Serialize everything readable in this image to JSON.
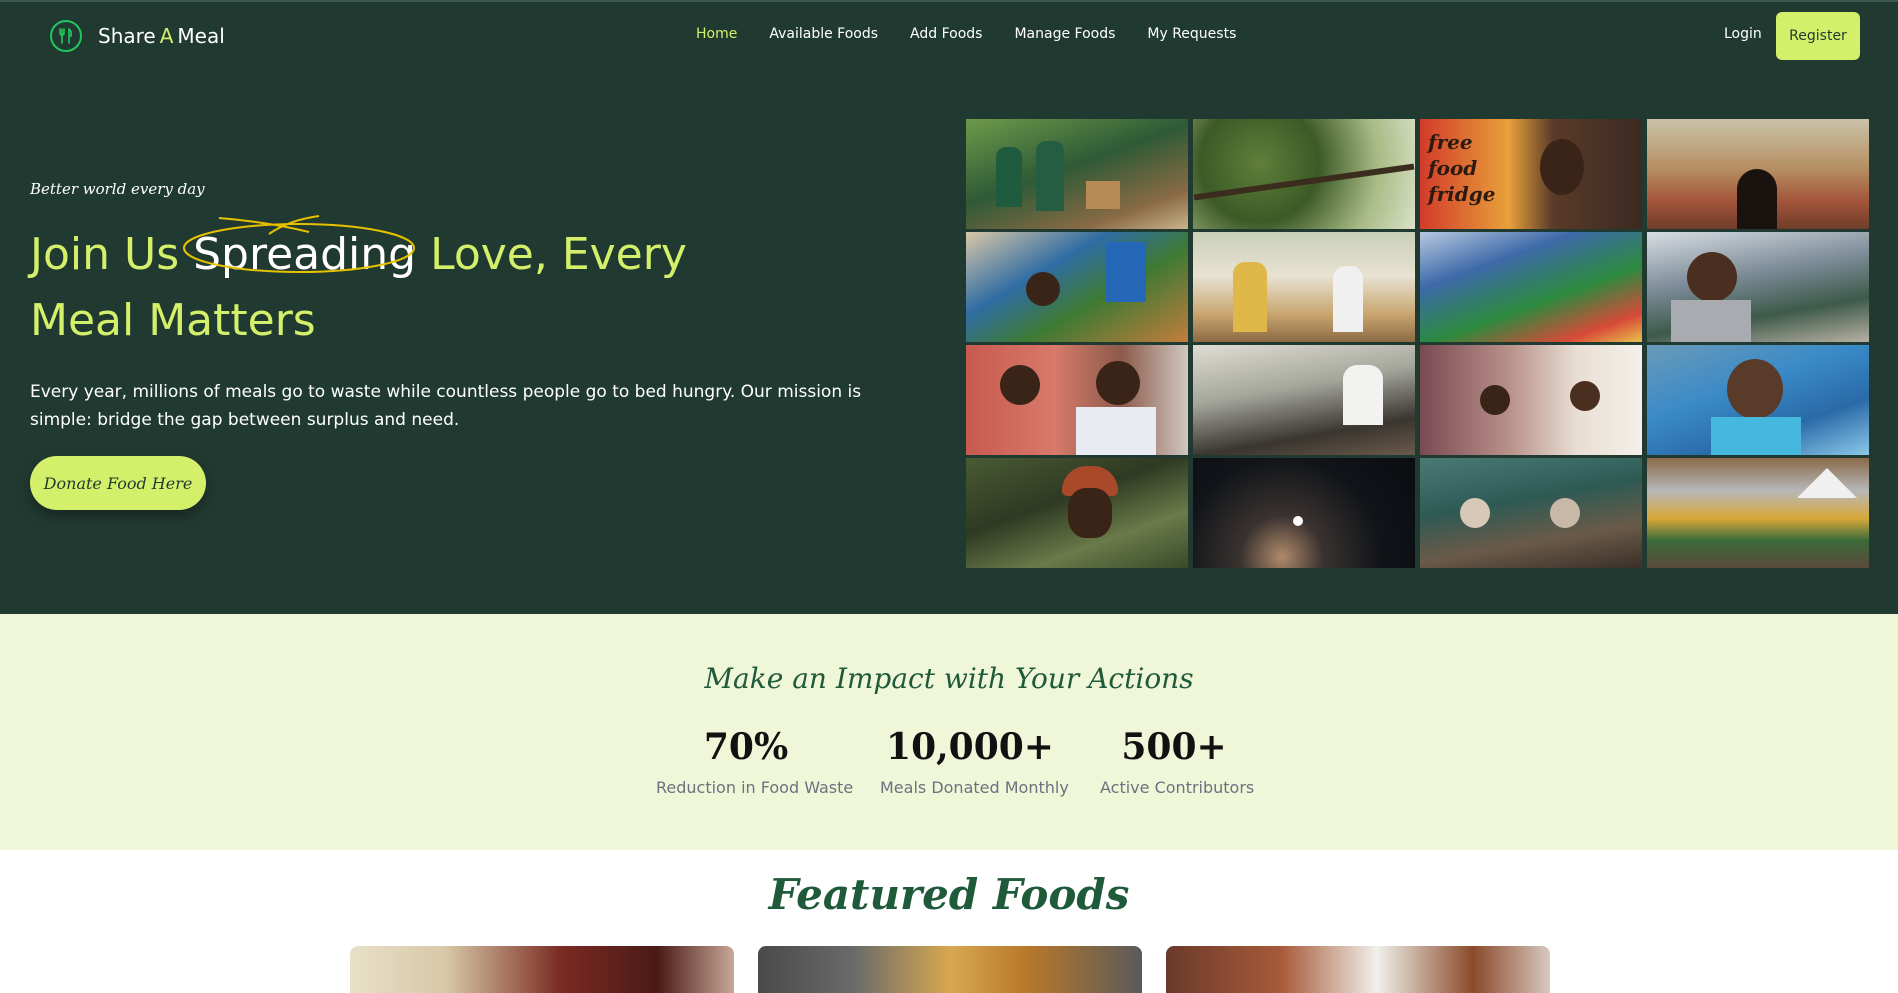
{
  "nav": {
    "brand_part1": "Share",
    "brand_accent": "A",
    "brand_part2": "Meal",
    "links": [
      "Home",
      "Available Foods",
      "Add Foods",
      "Manage Foods",
      "My Requests"
    ],
    "login": "Login",
    "register": "Register"
  },
  "hero": {
    "tagline": "Better world every day",
    "headline_before": "Join Us ",
    "headline_highlight": "Spreading",
    "headline_after": " Love, Every Meal Matters",
    "description": "Every year, millions of meals go to waste while countless people go to bed hungry. Our mission is simple: bridge the gap between surplus and need.",
    "cta": "Donate Food Here",
    "fridge_sign": "free food fridge"
  },
  "impact": {
    "title": "Make an Impact with Your Actions",
    "stats": [
      {
        "value": "70%",
        "label": "Reduction in Food Waste"
      },
      {
        "value": "10,000+",
        "label": "Meals Donated Monthly"
      },
      {
        "value": "500+",
        "label": "Active Contributors"
      }
    ]
  },
  "featured": {
    "title": "Featured Foods"
  },
  "colors": {
    "hero_bg": "#213a31",
    "accent": "#d4f06b",
    "impact_bg": "#f0f7d8",
    "heading_green": "#1f5a3a"
  }
}
